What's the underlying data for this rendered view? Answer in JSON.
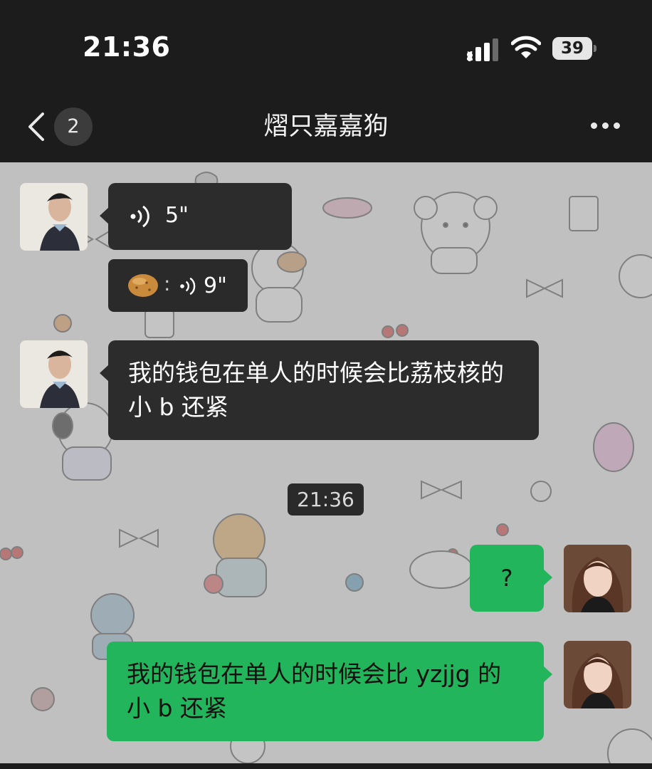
{
  "status_bar": {
    "time": "21:36",
    "battery": "39",
    "icons": [
      "signal-icon",
      "wifi-icon",
      "battery-icon"
    ]
  },
  "nav": {
    "unread_count": "2",
    "title": "熠只嘉嘉狗",
    "icons": [
      "chevron-left-icon",
      "more-dots-icon"
    ]
  },
  "messages": [
    {
      "side": "left",
      "kind": "voice",
      "duration": "5\""
    },
    {
      "side": "left",
      "kind": "quoted-voice",
      "quote_icon": "potato-emoji",
      "separator": ":",
      "duration": "9\""
    },
    {
      "side": "left",
      "kind": "text",
      "text": "我的钱包在单人的时候会比荔枝核的小 b 还紧"
    },
    {
      "kind": "timestamp",
      "text": "21:36"
    },
    {
      "side": "right",
      "kind": "text",
      "text": "?"
    },
    {
      "side": "right",
      "kind": "text",
      "text": "我的钱包在单人的时候会比 yzjjg 的小 b 还紧"
    }
  ],
  "colors": {
    "header_bg": "#1c1c1c",
    "incoming_bubble": "#2c2c2c",
    "outgoing_bubble": "#23b55b"
  }
}
